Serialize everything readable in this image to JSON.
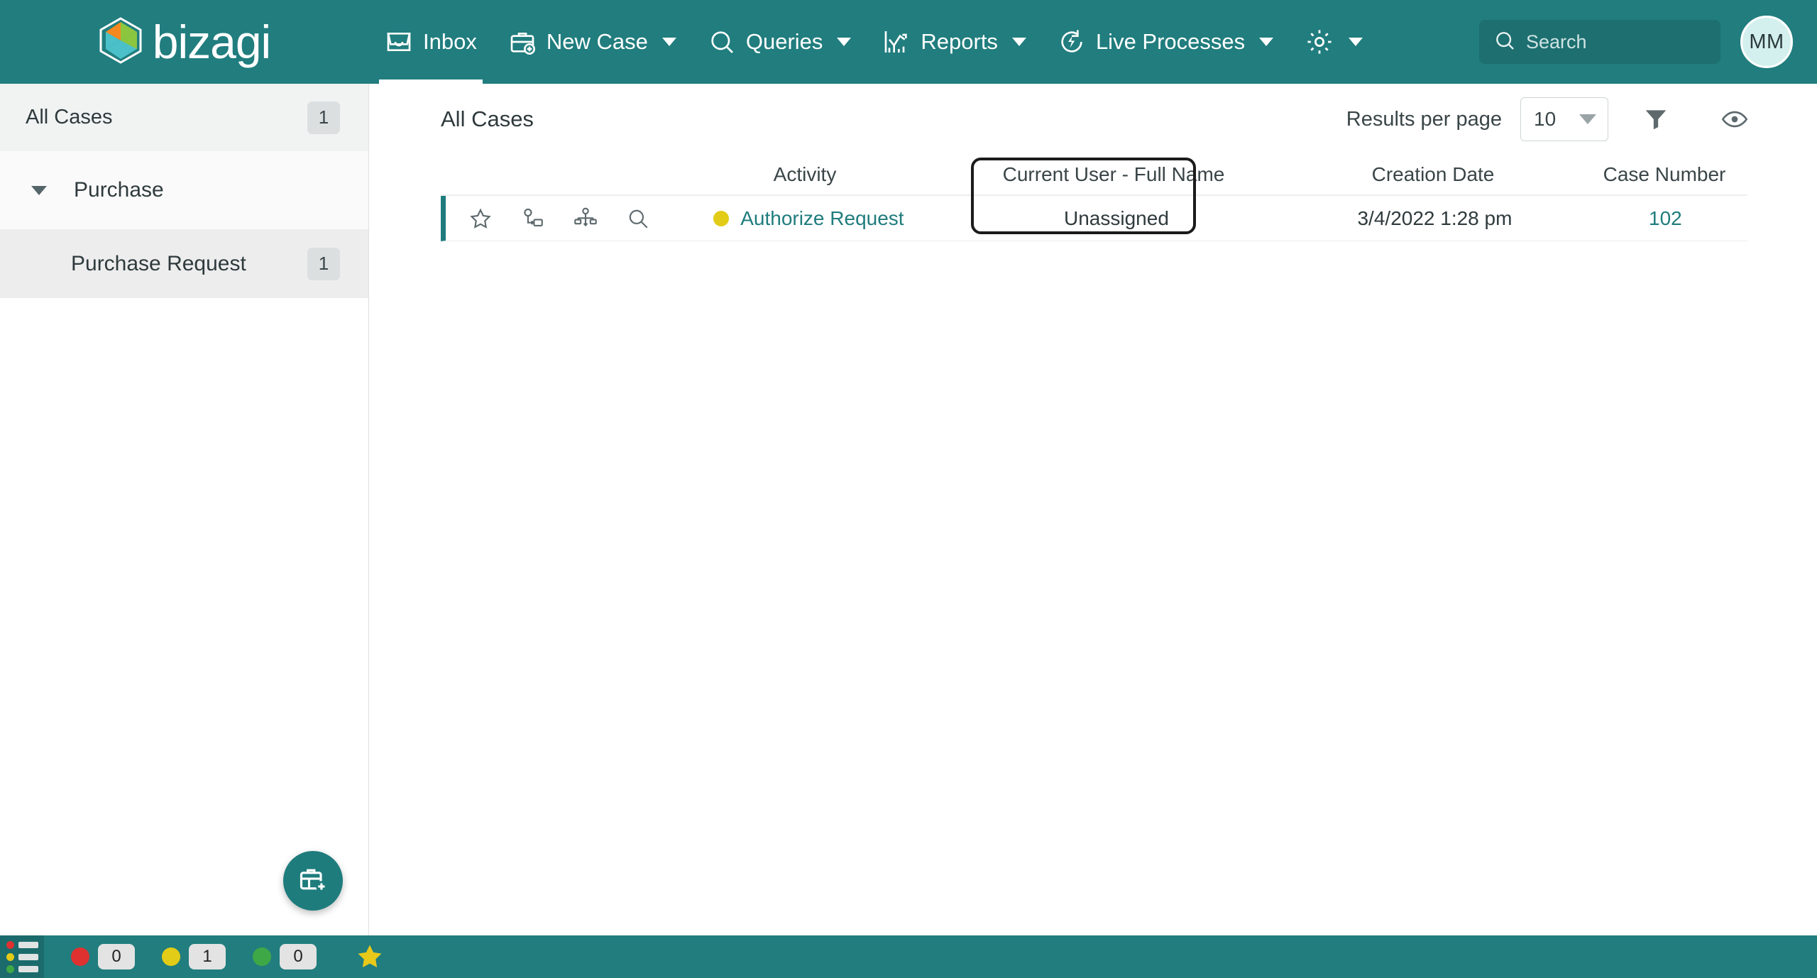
{
  "brand": {
    "name": "bizagi",
    "primary_color": "#217D7E",
    "accent_yellow": "#E2CC17",
    "logo_icon": "bizagi-cube-icon"
  },
  "topnav": {
    "items": [
      {
        "label": "Inbox",
        "icon": "inbox-icon",
        "has_caret": false,
        "active": true
      },
      {
        "label": "New Case",
        "icon": "briefcase-plus-icon",
        "has_caret": true,
        "active": false
      },
      {
        "label": "Queries",
        "icon": "magnifier-icon",
        "has_caret": true,
        "active": false
      },
      {
        "label": "Reports",
        "icon": "chart-icon",
        "has_caret": true,
        "active": false
      },
      {
        "label": "Live Processes",
        "icon": "lightning-circle-icon",
        "has_caret": true,
        "active": false
      },
      {
        "label": "",
        "icon": "gear-icon",
        "has_caret": true,
        "active": false
      }
    ],
    "search": {
      "placeholder": "Search",
      "value": "",
      "icon": "search-icon"
    },
    "avatar": {
      "initials": "MM"
    }
  },
  "sidebar": {
    "all_cases": {
      "label": "All Cases",
      "count": "1"
    },
    "purchase": {
      "label": "Purchase",
      "icon": "chevron-down-icon"
    },
    "purchase_request": {
      "label": "Purchase Request",
      "count": "1"
    },
    "fab": {
      "icon": "briefcase-plus-icon"
    }
  },
  "main": {
    "title": "All Cases",
    "results_per_page": {
      "label": "Results per page",
      "value": "10"
    },
    "filter_icon": "funnel-icon",
    "eye_icon": "eye-icon"
  },
  "table": {
    "row_action_icons": [
      "star-icon",
      "reassign-icon",
      "process-tree-icon",
      "magnifier-icon"
    ],
    "columns": [
      {
        "key": "actions",
        "label": ""
      },
      {
        "key": "activity",
        "label": "Activity"
      },
      {
        "key": "user",
        "label": "Current User - Full Name"
      },
      {
        "key": "date",
        "label": "Creation Date"
      },
      {
        "key": "case",
        "label": "Case Number"
      }
    ],
    "rows": [
      {
        "status_color": "#E2CC17",
        "activity": "Authorize Request",
        "user": "Unassigned",
        "date": "3/4/2022 1:28 pm",
        "case": "102"
      }
    ]
  },
  "statusbar": {
    "list_icon": "list-icon",
    "chips": [
      {
        "color": "#E03131",
        "count": "0"
      },
      {
        "color": "#E2CC17",
        "count": "1"
      },
      {
        "color": "#3FA846",
        "count": "0"
      }
    ],
    "star_icon": "star-icon"
  }
}
